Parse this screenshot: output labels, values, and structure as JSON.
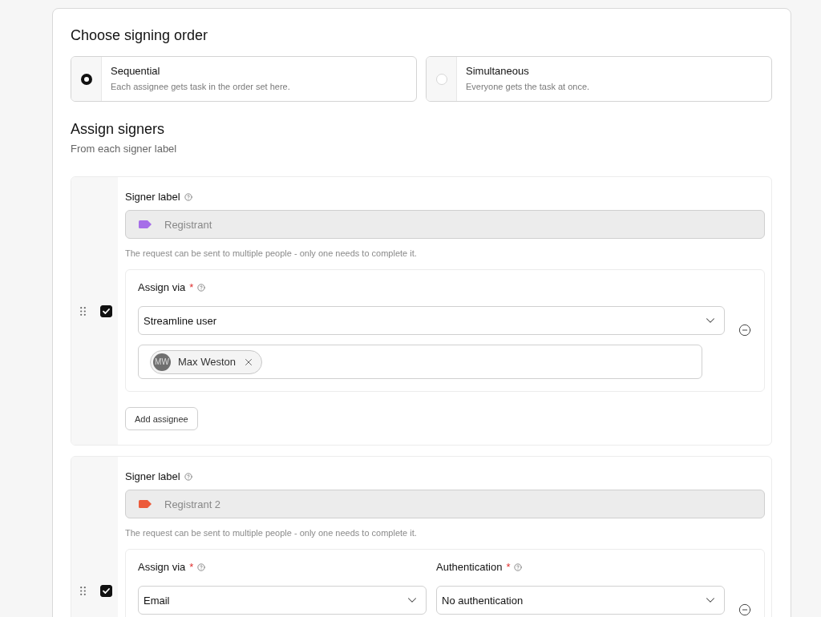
{
  "signing_order": {
    "title": "Choose signing order",
    "options": [
      {
        "label": "Sequential",
        "description": "Each assignee gets task in the order set here.",
        "selected": true
      },
      {
        "label": "Simultaneous",
        "description": "Everyone gets the task at once.",
        "selected": false
      }
    ]
  },
  "assign_signers": {
    "title": "Assign signers",
    "subtitle": "From each signer label"
  },
  "signers": [
    {
      "checked": true,
      "label_field": {
        "label": "Signer label",
        "value": "Registrant",
        "color": "#a66ee8",
        "disabled": true
      },
      "hint": "The request can be sent to multiple people - only one needs to complete it.",
      "fields": [
        {
          "label": "Assign via",
          "required_mark": "*",
          "value": "Streamline user"
        }
      ],
      "assignees": [
        {
          "initials": "MW",
          "name": "Max Weston"
        }
      ],
      "add_button": "Add assignee"
    },
    {
      "checked": true,
      "label_field": {
        "label": "Signer label",
        "value": "Registrant 2",
        "color": "#ec5b3b",
        "disabled": true
      },
      "hint": "The request can be sent to multiple people - only one needs to complete it.",
      "fields": [
        {
          "label": "Assign via",
          "required_mark": "*",
          "value": "Email"
        },
        {
          "label": "Authentication",
          "required_mark": "*",
          "value": "No authentication"
        }
      ]
    }
  ]
}
